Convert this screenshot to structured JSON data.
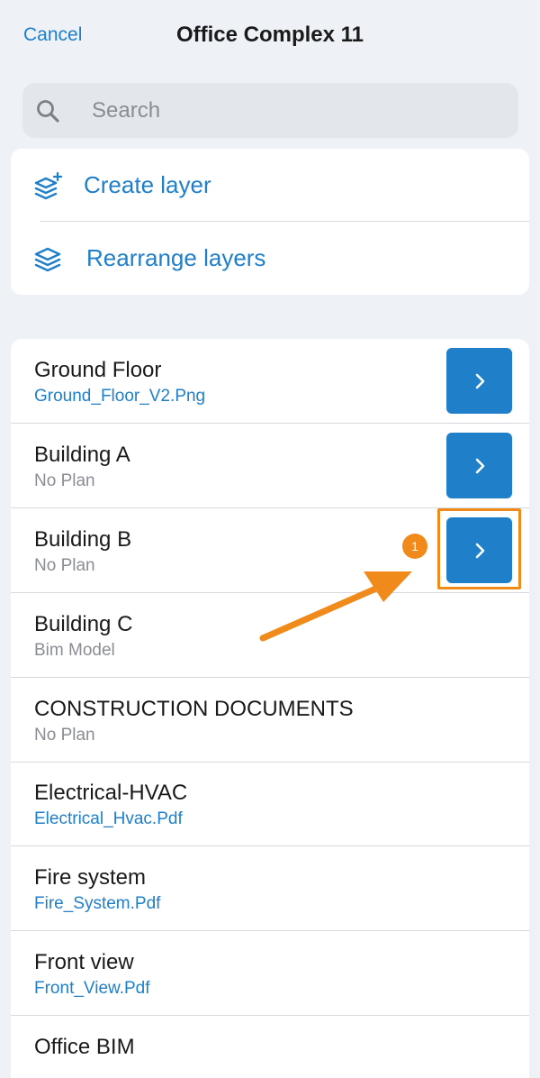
{
  "header": {
    "cancel_label": "Cancel",
    "title": "Office Complex 11"
  },
  "search": {
    "placeholder": "Search",
    "value": ""
  },
  "actions": [
    {
      "label": "Create layer",
      "icon": "layers-plus-icon"
    },
    {
      "label": "Rearrange layers",
      "icon": "layers-icon"
    }
  ],
  "layers": [
    {
      "name": "Ground Floor",
      "sub": "Ground_Floor_V2.Png",
      "sub_style": "link",
      "has_button": true
    },
    {
      "name": "Building A",
      "sub": "No Plan",
      "sub_style": "muted",
      "has_button": true
    },
    {
      "name": "Building B",
      "sub": "No Plan",
      "sub_style": "muted",
      "has_button": true
    },
    {
      "name": "Building C",
      "sub": "Bim Model",
      "sub_style": "muted",
      "has_button": false
    },
    {
      "name": "CONSTRUCTION DOCUMENTS",
      "sub": "No Plan",
      "sub_style": "muted",
      "has_button": false
    },
    {
      "name": "Electrical-HVAC",
      "sub": "Electrical_Hvac.Pdf",
      "sub_style": "link",
      "has_button": false
    },
    {
      "name": "Fire system",
      "sub": "Fire_System.Pdf",
      "sub_style": "link",
      "has_button": false
    },
    {
      "name": "Front view",
      "sub": "Front_View.Pdf",
      "sub_style": "link",
      "has_button": false
    },
    {
      "name": "Office BIM",
      "sub": "",
      "sub_style": "muted",
      "has_button": false
    }
  ],
  "annotation": {
    "badge_number": "1",
    "color": "#f08a1a"
  },
  "colors": {
    "accent": "#1f7fc8",
    "background": "#eef2f6",
    "muted_text": "#8a8d93"
  }
}
